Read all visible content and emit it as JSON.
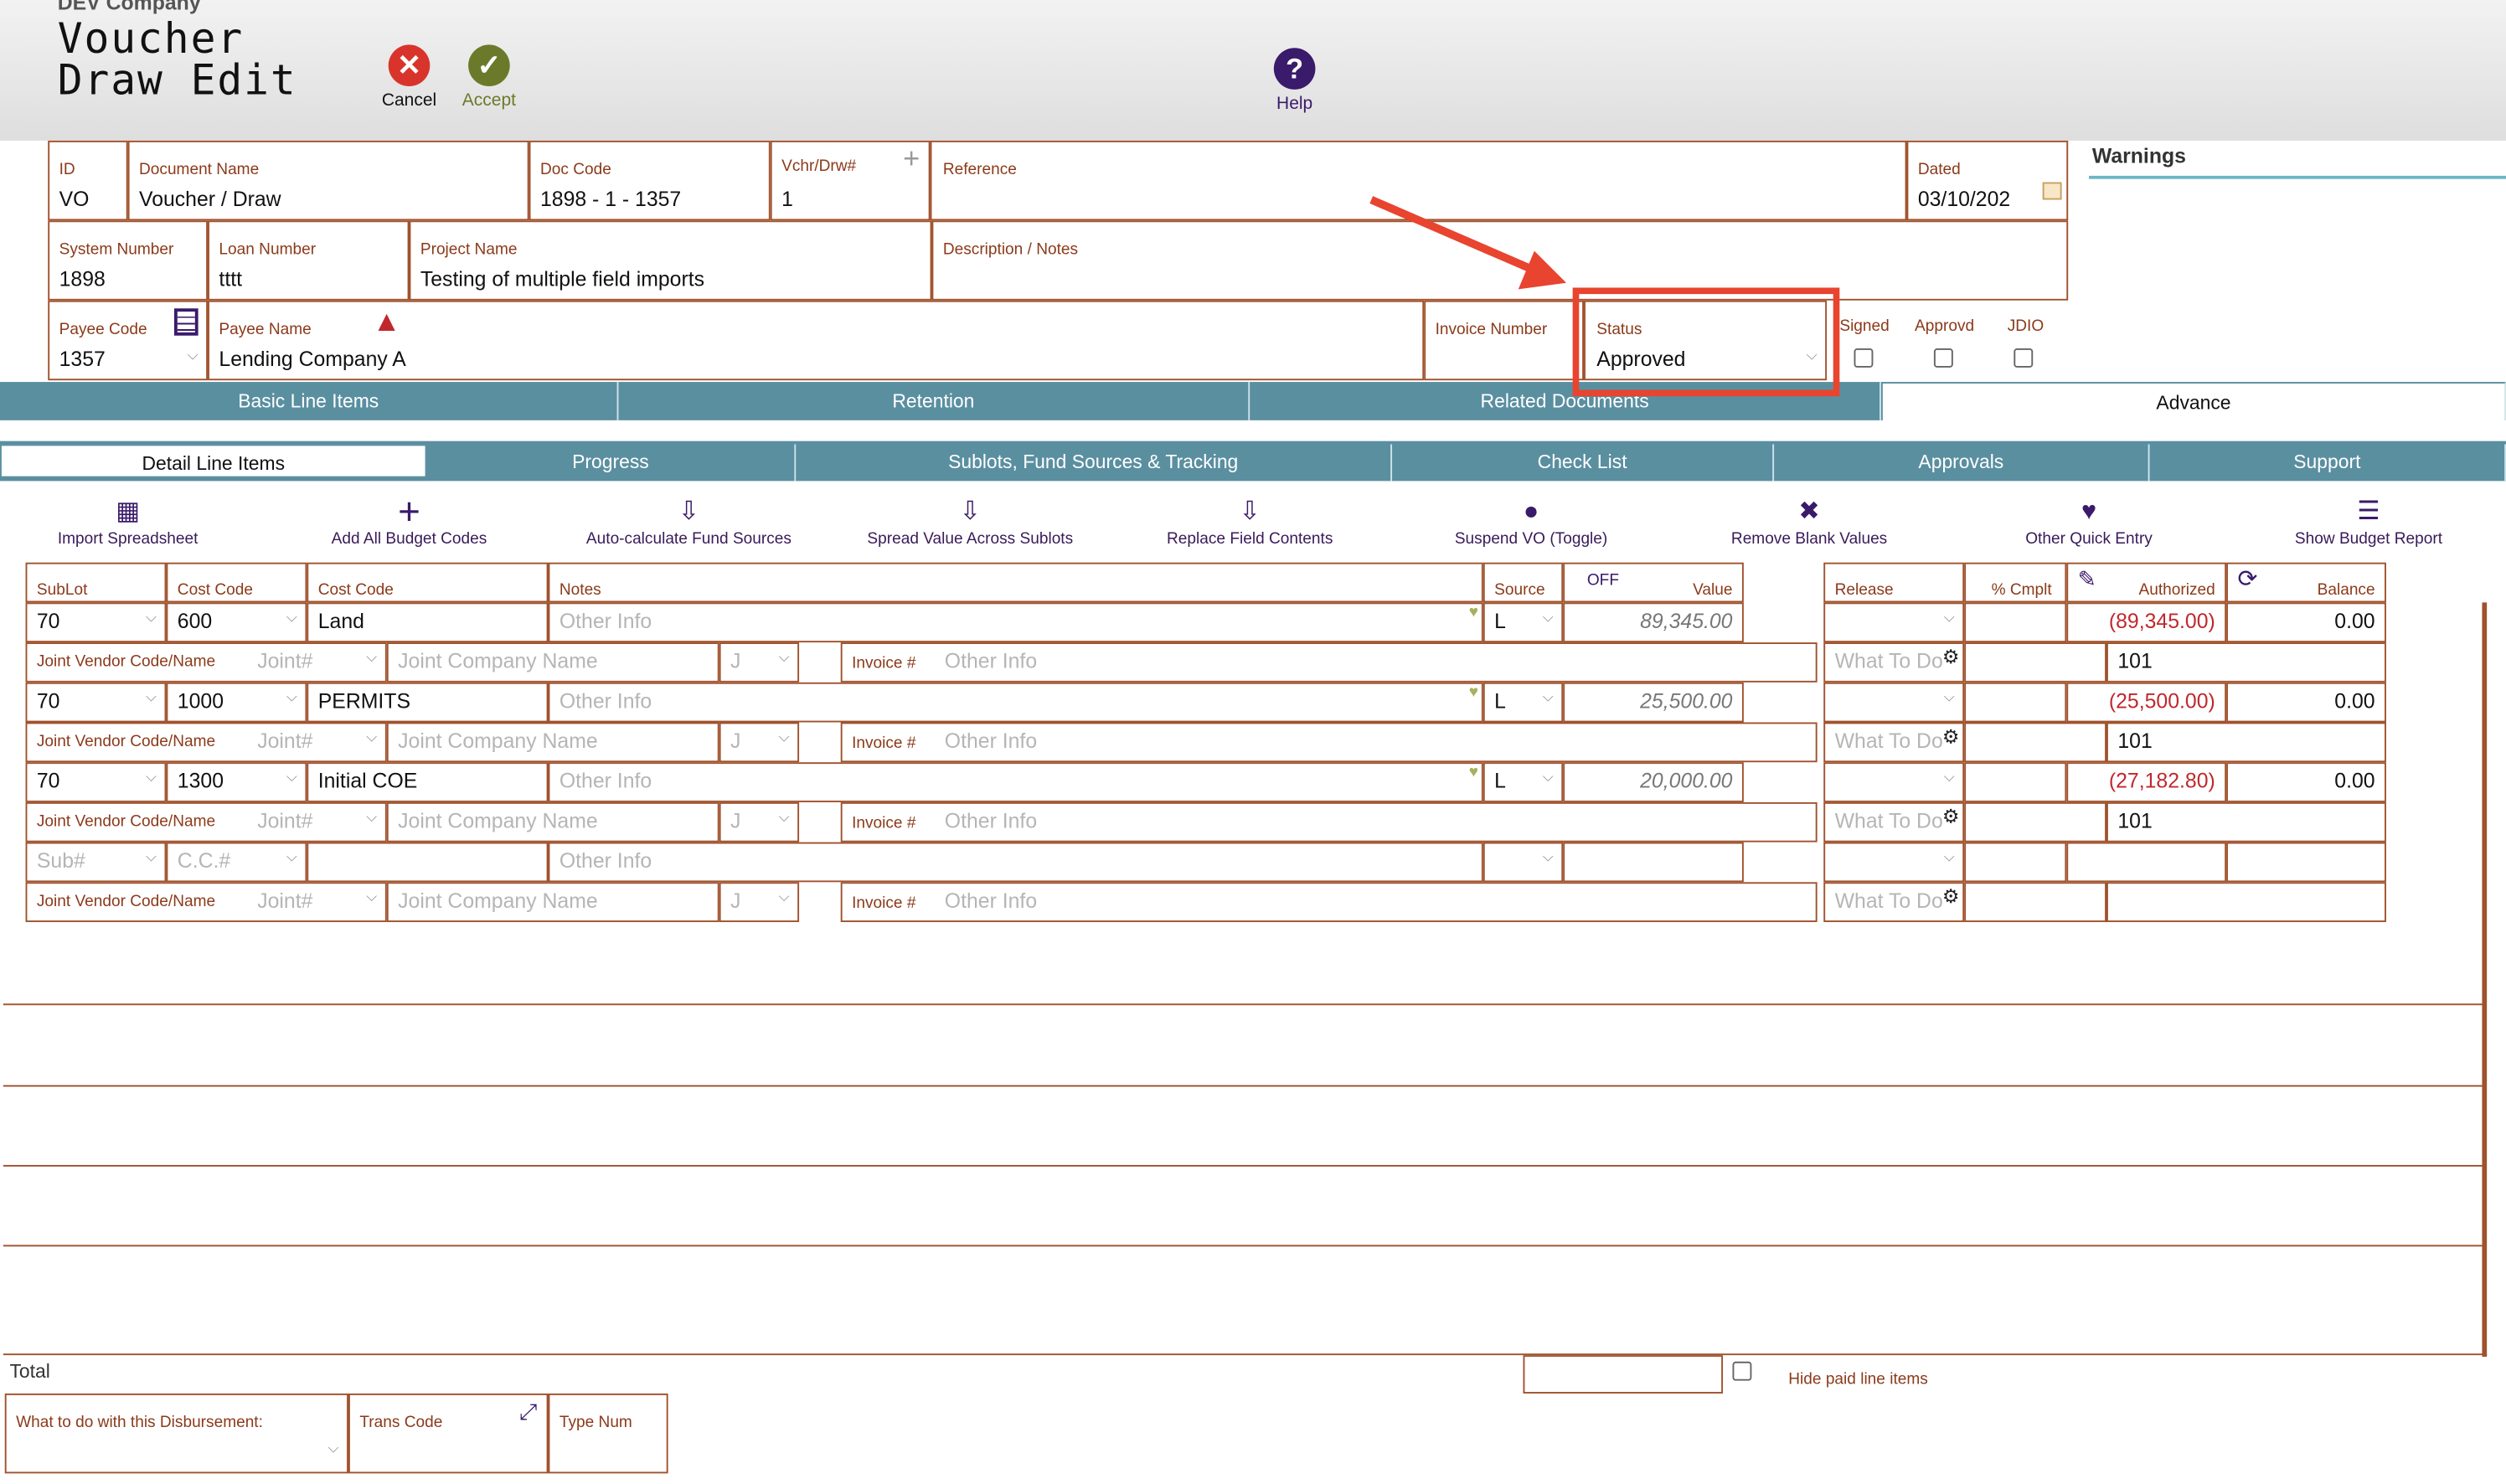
{
  "header": {
    "company": "DEV Company",
    "title_line1": "Voucher",
    "title_line2": "Draw Edit",
    "cancel": "Cancel",
    "accept": "Accept",
    "help": "Help"
  },
  "fields": {
    "id": {
      "label": "ID",
      "value": "VO"
    },
    "doc_name": {
      "label": "Document Name",
      "value": "Voucher / Draw"
    },
    "doc_code": {
      "label": "Doc Code",
      "value": "1898 - 1 - 1357"
    },
    "vchr": {
      "label": "Vchr/Drw#",
      "value": "1"
    },
    "reference": {
      "label": "Reference",
      "value": ""
    },
    "dated": {
      "label": "Dated",
      "value": "03/10/202"
    },
    "system_number": {
      "label": "System Number",
      "value": "1898"
    },
    "loan_number": {
      "label": "Loan Number",
      "value": "tttt"
    },
    "project_name": {
      "label": "Project Name",
      "value": "Testing of multiple field imports"
    },
    "description": {
      "label": "Description / Notes",
      "value": ""
    },
    "payee_code": {
      "label": "Payee Code",
      "value": "1357"
    },
    "payee_name": {
      "label": "Payee Name",
      "value": "Lending Company A"
    },
    "invoice_number": {
      "label": "Invoice Number",
      "value": ""
    },
    "status": {
      "label": "Status",
      "value": "Approved"
    },
    "signed": "Signed",
    "approvd": "Approvd",
    "jdio": "JDIO"
  },
  "warnings": "Warnings",
  "tabs": [
    "Basic Line Items",
    "Retention",
    "Related Documents",
    "Advance"
  ],
  "subtabs": [
    "Detail Line Items",
    "Progress",
    "Sublots, Fund Sources & Tracking",
    "Check List",
    "Approvals",
    "Support"
  ],
  "actions": [
    "Import Spreadsheet",
    "Add All Budget Codes",
    "Auto-calculate Fund Sources",
    "Spread Value Across Sublots",
    "Replace Field Contents",
    "Suspend VO (Toggle)",
    "Remove Blank Values",
    "Other Quick Entry",
    "Show Budget Report"
  ],
  "columns": {
    "sublot": "SubLot",
    "costcode1": "Cost Code",
    "costcode2": "Cost Code",
    "notes": "Notes",
    "source": "Source",
    "off": "OFF",
    "value": "Value",
    "release": "Release",
    "cmplt": "% Cmplt",
    "authorized": "Authorized",
    "balance": "Balance"
  },
  "placeholders": {
    "other_info": "Other Info",
    "joint": "Joint#",
    "joint_company": "Joint Company Name",
    "j": "J",
    "invoice": "Invoice #",
    "what_to_do": "What To Do",
    "sub": "Sub#",
    "cc": "C.C.#",
    "joint_vendor": "Joint Vendor Code/Name"
  },
  "rows": [
    {
      "sublot": "70",
      "costcode": "600",
      "desc": "Land",
      "source": "L",
      "value": "89,345.00",
      "authorized": "(89,345.00)",
      "balance": "0.00",
      "code2": "101"
    },
    {
      "sublot": "70",
      "costcode": "1000",
      "desc": "PERMITS",
      "source": "L",
      "value": "25,500.00",
      "authorized": "(25,500.00)",
      "balance": "0.00",
      "code2": "101"
    },
    {
      "sublot": "70",
      "costcode": "1300",
      "desc": "Initial COE",
      "source": "L",
      "value": "20,000.00",
      "authorized": "(27,182.80)",
      "balance": "0.00",
      "code2": "101"
    }
  ],
  "footer": {
    "total": "Total",
    "hide_paid": "Hide paid line items",
    "what_to_do": "What to do with this Disbursement:",
    "trans_code": "Trans Code",
    "type_num": "Type Num"
  },
  "colors": {
    "teal": "#5a8fa0",
    "border": "#a0522d",
    "annotation": "#e8442f"
  }
}
